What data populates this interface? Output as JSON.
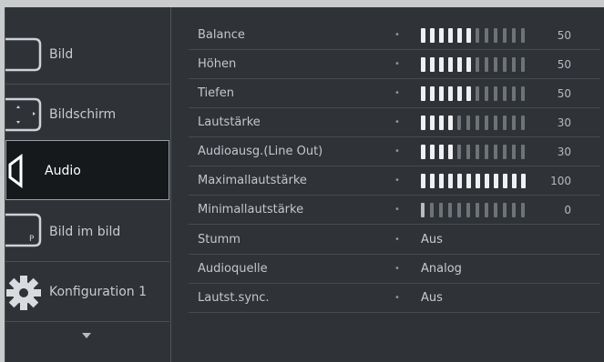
{
  "sidebar": {
    "items": [
      {
        "label": "Bild",
        "icon": "screen-icon",
        "active": false
      },
      {
        "label": "Bildschirm",
        "icon": "screen-adjust-icon",
        "active": false
      },
      {
        "label": "Audio",
        "icon": "speaker-icon",
        "active": true
      },
      {
        "label": "Bild im bild",
        "icon": "pip-icon",
        "active": false
      },
      {
        "label": "Konfiguration 1",
        "icon": "gear-icon",
        "active": false
      }
    ],
    "more_icon": "chevron-down-icon"
  },
  "settings": [
    {
      "label": "Balance",
      "type": "slider",
      "value": 50,
      "max": 100,
      "value_text": "50"
    },
    {
      "label": "Höhen",
      "type": "slider",
      "value": 50,
      "max": 100,
      "value_text": "50"
    },
    {
      "label": "Tiefen",
      "type": "slider",
      "value": 50,
      "max": 100,
      "value_text": "50"
    },
    {
      "label": "Lautstärke",
      "type": "slider",
      "value": 30,
      "max": 100,
      "value_text": "30"
    },
    {
      "label": "Audioausg.(Line Out)",
      "type": "slider",
      "value": 30,
      "max": 100,
      "value_text": "30"
    },
    {
      "label": "Maximallautstärke",
      "type": "slider",
      "value": 100,
      "max": 100,
      "value_text": "100"
    },
    {
      "label": "Minimallautstärke",
      "type": "slider",
      "value": 0,
      "max": 100,
      "value_text": "0"
    },
    {
      "label": "Stumm",
      "type": "option",
      "value_text": "Aus"
    },
    {
      "label": "Audioquelle",
      "type": "option",
      "value_text": "Analog"
    },
    {
      "label": "Lautst.sync.",
      "type": "option",
      "value_text": "Aus"
    }
  ],
  "colors": {
    "background": "#2f3338",
    "active_bg": "#16191c",
    "segment_on": "#eef0f2",
    "segment_off": "#6e7378"
  }
}
